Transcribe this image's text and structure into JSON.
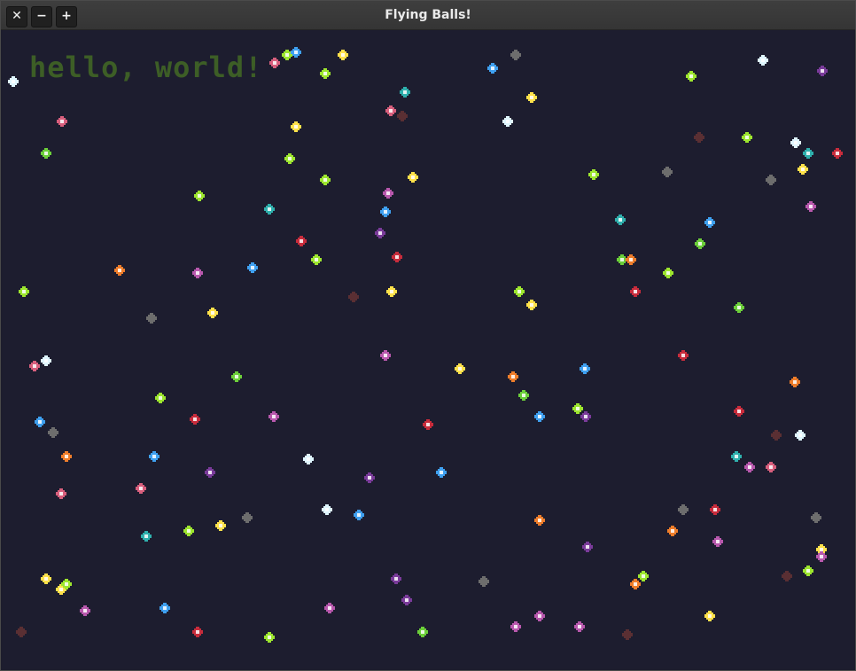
{
  "window": {
    "title": "Flying Balls!",
    "buttons": {
      "close": "✕",
      "minimize": "−",
      "maximize": "+"
    }
  },
  "canvas": {
    "text": "hello, world!",
    "text_color": "#3d5e26",
    "background": "#1d1d2f"
  },
  "palette": {
    "white": "#dff6ff",
    "yellow": "#ffe14a",
    "orange": "#ef7d2a",
    "lime": "#9de62e",
    "green": "#6ccf3a",
    "pink": "#d85f7d",
    "red": "#c82c3c",
    "blue": "#3fa0f0",
    "teal": "#2fb0ad",
    "purple": "#7a3b9a",
    "magenta": "#b858ad",
    "gray": "#6d6d6d",
    "brown": "#5a2f33"
  },
  "ball_count": 131
}
